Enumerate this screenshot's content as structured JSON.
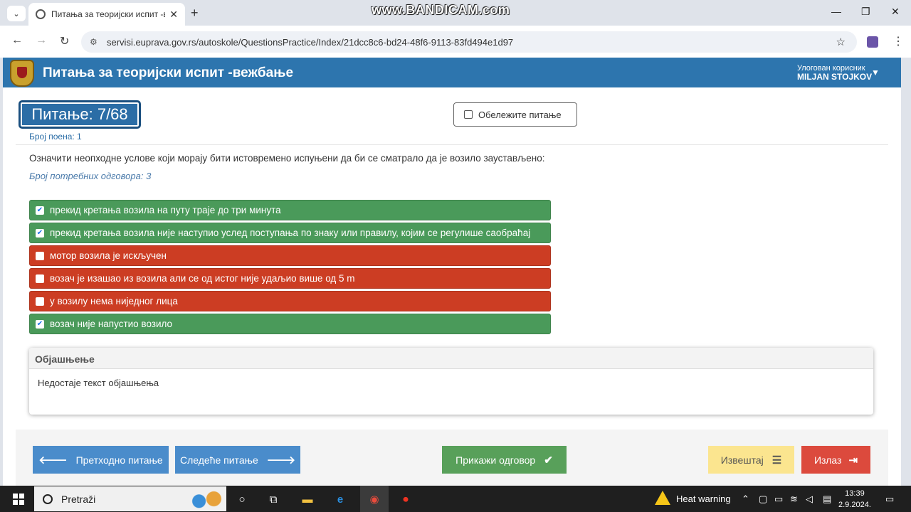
{
  "browser": {
    "tab_title": "Питања за теоријски испит -ве",
    "tab_list_icon": "chevron-down-icon",
    "close_tab": "✕",
    "new_tab": "+",
    "url": "servisi.euprava.gov.rs/autoskole/QuestionsPractice/Index/21dcc8c6-bd24-48f6-9113-83fd494e1d97",
    "recorder_watermark": "www.BANDICAM.com"
  },
  "header": {
    "title": "Питања за теоријски испит -вежбање",
    "user_label": "Улогован корисник",
    "user_name": "MILJAN STOJKOV"
  },
  "question": {
    "badge": "Питање: 7/68",
    "points": "Број поена: 1",
    "mark_label": "Обележите питање",
    "text": "Означити неопходне услове који морају бити истовремено испуњени да би се сматрало да је возило заустављено:",
    "required": "Број потребних одговора: 3"
  },
  "answers": [
    {
      "text": "прекид кретања возила на путу траје до три минута",
      "checked": true,
      "status": "correct",
      "color": "#4a9a5a"
    },
    {
      "text": "прекид кретања возила није наступио услед поступања по знаку или правилу, којим се регулише саобраћај",
      "checked": true,
      "status": "correct",
      "color": "#4a9a5a"
    },
    {
      "text": "мотор возила је искључен",
      "checked": false,
      "status": "wrong",
      "color": "#cc3d23"
    },
    {
      "text": "возач је изашао из возила али се од истог није удаљио више од 5 m",
      "checked": false,
      "status": "wrong",
      "color": "#cc3d23"
    },
    {
      "text": "у возилу нема ниједног лица",
      "checked": false,
      "status": "wrong",
      "color": "#cc3d23"
    },
    {
      "text": "возач није напустио возило",
      "checked": true,
      "status": "correct",
      "color": "#4a9a5a"
    }
  ],
  "explanation": {
    "title": "Објашњење",
    "body": "Недостаје текст објашњења"
  },
  "footer": {
    "prev": "Претходно питање",
    "next": "Следеће питање",
    "show": "Прикажи одговор",
    "report": "Извештај",
    "exit": "Излаз"
  },
  "colors": {
    "header": "#2d75ae",
    "blue_button": "#4a8ccb",
    "green_button": "#58a05a",
    "yellow_button": "#fbe58f",
    "red_button": "#dc4a3d"
  },
  "taskbar": {
    "search": "Pretraži",
    "weather": "Heat warning",
    "time": "13:39",
    "date": "2.9.2024."
  }
}
